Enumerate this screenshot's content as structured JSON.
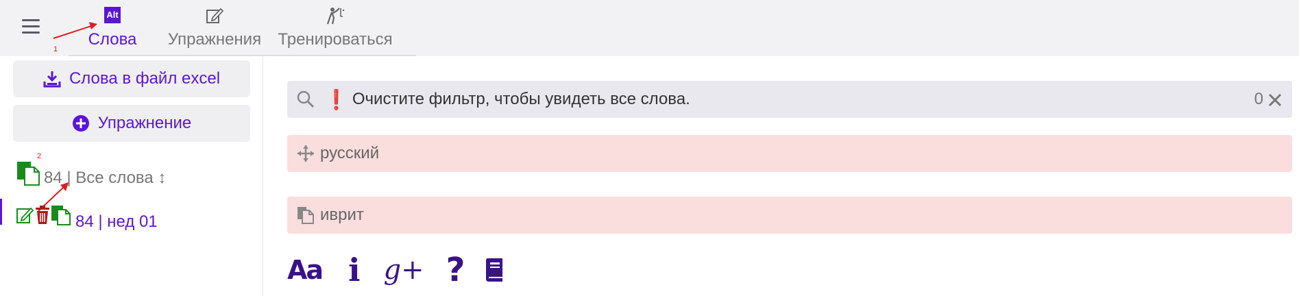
{
  "header": {
    "tabs": [
      {
        "label": "Слова",
        "icon": "alt-icon",
        "active": true
      },
      {
        "label": "Упражнения",
        "icon": "edit-icon",
        "active": false
      },
      {
        "label": "Тренироваться",
        "icon": "golfer-icon",
        "active": false
      }
    ],
    "alt_icon_text": "Alt"
  },
  "sidebar": {
    "excel_button_label": "Слова в файл excel",
    "exercise_button_label": "Упражнение",
    "lists": [
      {
        "text": "84 | Все слова ↕",
        "selected": false
      },
      {
        "text": "84 | нед 01",
        "selected": true
      }
    ]
  },
  "main": {
    "filter": {
      "warning_glyph": "❗",
      "text": "Очистите фильтр, чтобы увидеть все слова.",
      "count": "0"
    },
    "fields": [
      {
        "label": "русский",
        "icon": "move-icon"
      },
      {
        "label": "иврит",
        "icon": "copy-icon"
      }
    ],
    "bottom_icons": {
      "font_label": "Aa",
      "info_label": "i",
      "gplus_label": "g+",
      "help_label": "?"
    }
  },
  "annotations": [
    "1",
    "2"
  ],
  "colors": {
    "accent": "#5a16d6",
    "topbar_bg": "#f2f2f5",
    "field_bg": "#fadddd",
    "filter_bg": "#e8e8ee",
    "annotation": "#d62020",
    "icon_green": "#1a8a1a",
    "icon_red": "#b01818",
    "dark_purple": "#3a1288"
  }
}
